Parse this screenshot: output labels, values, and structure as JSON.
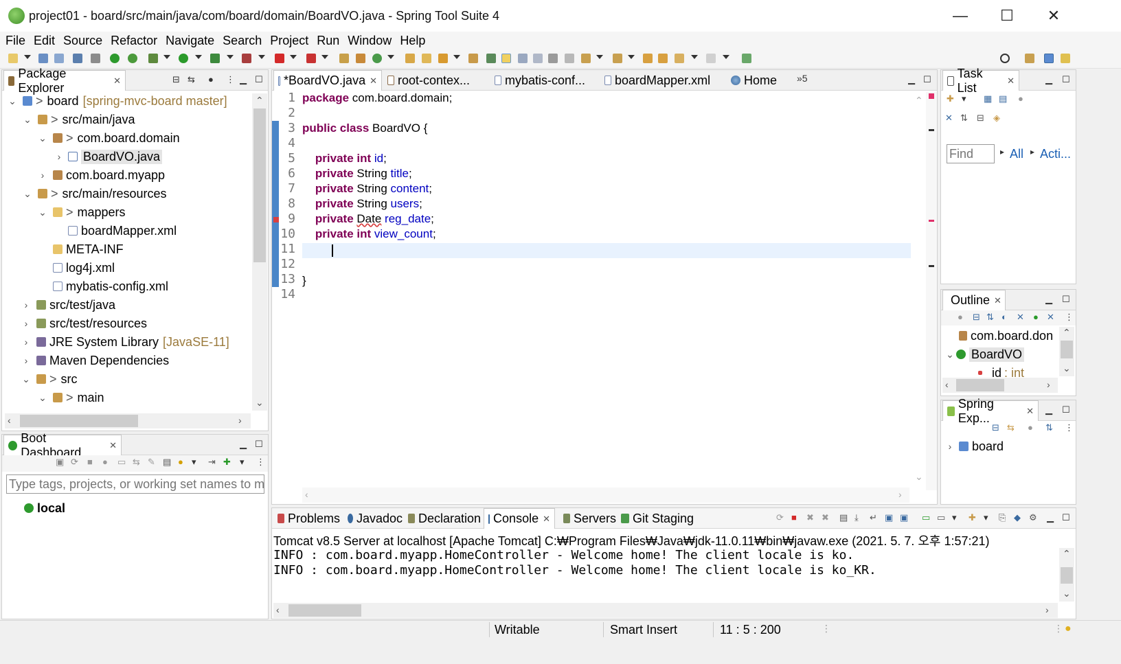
{
  "window": {
    "title": "project01 - board/src/main/java/com/board/domain/BoardVO.java - Spring Tool Suite 4",
    "minimize": "—",
    "maximize": "☐",
    "close": "✕"
  },
  "menu": [
    "File",
    "Edit",
    "Source",
    "Refactor",
    "Navigate",
    "Search",
    "Project",
    "Run",
    "Window",
    "Help"
  ],
  "package_explorer": {
    "tab": "Package Explorer",
    "items": [
      {
        "label": "board",
        "decor": "[spring-mvc-board master]",
        "chev": "⌄",
        "prefix": ">"
      },
      {
        "label": "src/main/java",
        "chev": "⌄",
        "prefix": ">"
      },
      {
        "label": "com.board.domain",
        "chev": "⌄",
        "prefix": ">"
      },
      {
        "label": "BoardVO.java",
        "chev": "›"
      },
      {
        "label": "com.board.myapp",
        "chev": "›"
      },
      {
        "label": "src/main/resources",
        "chev": "⌄",
        "prefix": ">"
      },
      {
        "label": "mappers",
        "chev": "⌄",
        "prefix": ">"
      },
      {
        "label": "boardMapper.xml"
      },
      {
        "label": "META-INF"
      },
      {
        "label": "log4j.xml"
      },
      {
        "label": "mybatis-config.xml"
      },
      {
        "label": "src/test/java",
        "chev": "›"
      },
      {
        "label": "src/test/resources",
        "chev": "›"
      },
      {
        "label": "JRE System Library",
        "decor": "[JavaSE-11]",
        "chev": "›"
      },
      {
        "label": "Maven Dependencies",
        "chev": "›"
      },
      {
        "label": "src",
        "chev": "⌄",
        "prefix": ">"
      },
      {
        "label": "main",
        "chev": "⌄",
        "prefix": ">"
      }
    ]
  },
  "boot_dashboard": {
    "tab": "Boot Dashboard",
    "filter_placeholder": "Type tags, projects, or working set names to m",
    "local": "local"
  },
  "editor": {
    "tabs": [
      "*BoardVO.java",
      "root-contex...",
      "mybatis-conf...",
      "boardMapper.xml",
      "Home"
    ],
    "overflow": "»5",
    "line_numbers": [
      "1",
      "2",
      "3",
      "4",
      "5",
      "6",
      "7",
      "8",
      "9",
      "10",
      "11",
      "12",
      "13",
      "14"
    ]
  },
  "task_list": {
    "tab": "Task List",
    "find_placeholder": "Find",
    "all": "All",
    "acti": "Acti..."
  },
  "outline": {
    "tab": "Outline",
    "items": [
      "com.board.don",
      "BoardVO",
      "id",
      ": int"
    ]
  },
  "spring_explorer": {
    "tab": "Spring Exp...",
    "item": "board"
  },
  "bottom": {
    "tabs": [
      "Problems",
      "Javadoc",
      "Declaration",
      "Console",
      "Servers",
      "Git Staging"
    ],
    "console_header": "Tomcat v8.5 Server at localhost [Apache Tomcat] C:₩Program Files₩Java₩jdk-11.0.11₩bin₩javaw.exe  (2021. 5. 7. 오후 1:57:21)",
    "console_lines": [
      "INFO : com.board.myapp.HomeController - Welcome home! The client locale is ko.",
      "INFO : com.board.myapp.HomeController - Welcome home! The client locale is ko_KR."
    ]
  },
  "status": {
    "writable": "Writable",
    "insert": "Smart Insert",
    "position": "11 : 5 : 200"
  },
  "colors": {
    "keyword": "#7f0055",
    "field": "#0000c0",
    "current_line": "#e8f2fe"
  }
}
